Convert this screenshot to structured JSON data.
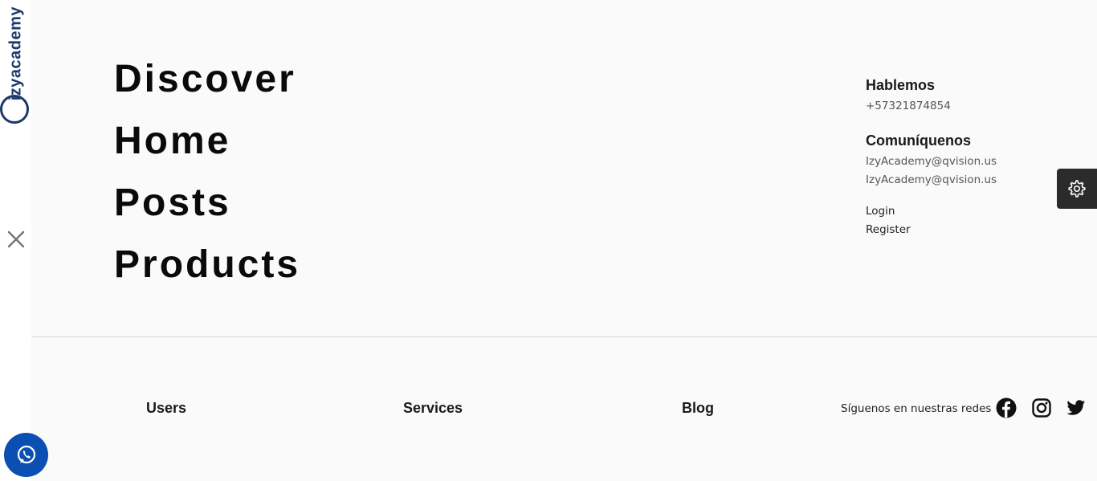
{
  "brand": {
    "logo_text": "izyacademy"
  },
  "menu": {
    "items": [
      {
        "label": "Discover"
      },
      {
        "label": "Home"
      },
      {
        "label": "Posts"
      },
      {
        "label": "Products"
      }
    ]
  },
  "contact": {
    "talk_heading": "Hablemos",
    "phone": "+57321874854",
    "reach_heading": "Comuníquenos",
    "emails": [
      "IzyAcademy@qvision.us",
      "IzyAcademy@qvision.us"
    ],
    "login": "Login",
    "register": "Register"
  },
  "footer": {
    "links": [
      {
        "label": "Users"
      },
      {
        "label": "Services"
      },
      {
        "label": "Blog"
      }
    ],
    "follow_text": "Síguenos en nuestras redes"
  },
  "icons": {
    "close": "close-icon",
    "whatsapp": "whatsapp-icon",
    "settings": "gear-icon",
    "facebook": "facebook-icon",
    "instagram": "instagram-icon",
    "twitter": "twitter-icon"
  },
  "colors": {
    "background": "#fafafa",
    "brand": "#1b3a6b",
    "whatsapp_button": "#0b4fb3",
    "settings_button": "#2b2b2b"
  }
}
